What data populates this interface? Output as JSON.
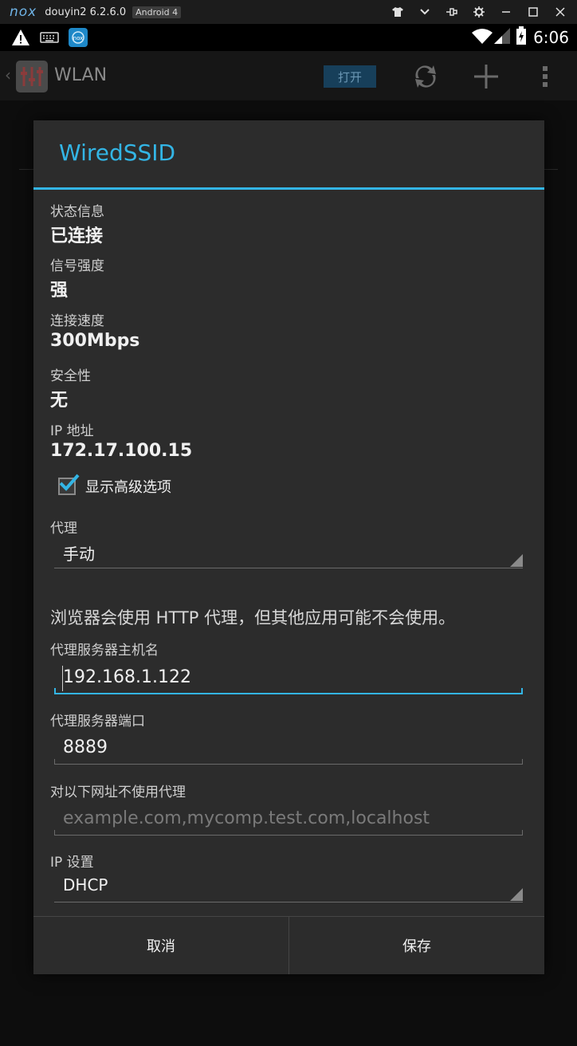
{
  "emulator": {
    "logo": "nox",
    "title": "douyin2 6.2.6.0",
    "badge": "Android 4",
    "controls": [
      "shirt-icon",
      "chevron-down-icon",
      "pin-icon",
      "gear-icon",
      "minimize-icon",
      "maximize-icon",
      "close-icon"
    ]
  },
  "status_bar": {
    "time": "6:06",
    "left_icons": [
      "warning-icon",
      "keyboard-icon",
      "nox-app-icon"
    ],
    "right_icons": [
      "wifi-icon",
      "signal-icon",
      "battery-icon"
    ]
  },
  "app_bar": {
    "title": "WLAN",
    "toggle_label": "打开",
    "actions": [
      "refresh-icon",
      "add-icon",
      "overflow-menu-icon"
    ]
  },
  "dialog": {
    "title": "WiredSSID",
    "info": [
      {
        "label": "状态信息",
        "value": "已连接"
      },
      {
        "label": "信号强度",
        "value": "强"
      },
      {
        "label": "连接速度",
        "value": "300Mbps"
      },
      {
        "label": "安全性",
        "value": "无"
      },
      {
        "label": "IP 地址",
        "value": "172.17.100.15"
      }
    ],
    "advanced_checkbox": {
      "label": "显示高级选项",
      "checked": true
    },
    "proxy": {
      "label": "代理",
      "selected": "手动"
    },
    "proxy_note": "浏览器会使用 HTTP 代理，但其他应用可能不会使用。",
    "proxy_host": {
      "label": "代理服务器主机名",
      "value": "192.168.1.122"
    },
    "proxy_port": {
      "label": "代理服务器端口",
      "value": "8889"
    },
    "bypass": {
      "label": "对以下网址不使用代理",
      "placeholder": "example.com,mycomp.test.com,localhost"
    },
    "ip_settings": {
      "label": "IP 设置",
      "selected": "DHCP"
    },
    "buttons": {
      "cancel": "取消",
      "save": "保存"
    }
  },
  "colors": {
    "accent": "#33b5e5",
    "dialog_bg": "#2c2c2c"
  }
}
